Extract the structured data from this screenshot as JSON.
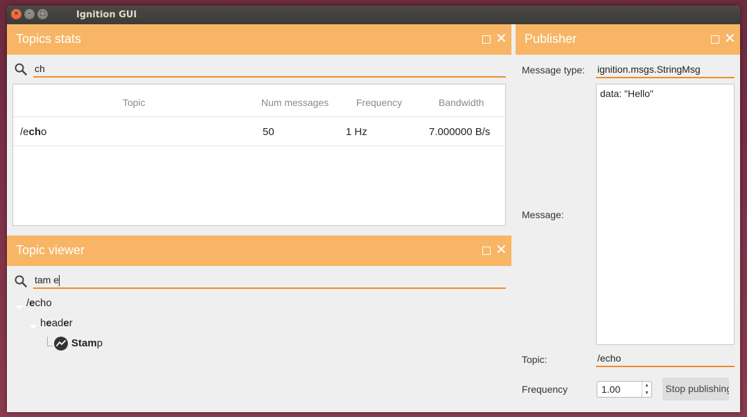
{
  "window": {
    "title": "Ignition GUI"
  },
  "topics_stats": {
    "title": "Topics stats",
    "search_value": "ch",
    "columns": [
      "Topic",
      "Num messages",
      "Frequency",
      "Bandwidth"
    ],
    "rows": [
      {
        "topic_pre": "/e",
        "topic_match": "ch",
        "topic_post": "o",
        "num_messages": "50",
        "frequency": "1 Hz",
        "bandwidth": "7.000000 B/s"
      }
    ]
  },
  "topic_viewer": {
    "title": "Topic viewer",
    "search_value": "tam e",
    "tree": {
      "echo": {
        "pre": "/",
        "match": "e",
        "post": "cho"
      },
      "header": {
        "a": "h",
        "b": "e",
        "c": "ad",
        "d": "e",
        "e": "r"
      },
      "stamp": {
        "match": "Stam",
        "post": "p"
      }
    }
  },
  "publisher": {
    "title": "Publisher",
    "message_type_label": "Message type:",
    "message_type_value": "ignition.msgs.StringMsg",
    "message_label": "Message:",
    "message_value": "data: \"Hello\"",
    "topic_label": "Topic:",
    "topic_value": "/echo",
    "frequency_label": "Frequency",
    "frequency_value": "1.00",
    "button_label": "Stop publishing"
  },
  "colors": {
    "accent": "#f7b565",
    "underline": "#f08b2a"
  }
}
